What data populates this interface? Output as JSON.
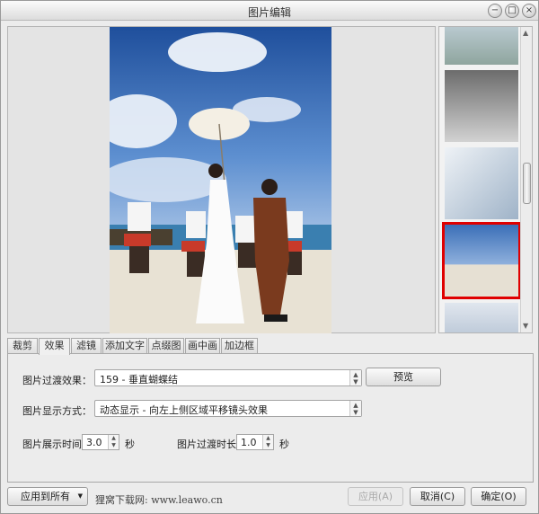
{
  "window": {
    "title": "图片编辑"
  },
  "tabs": [
    {
      "label": "裁剪"
    },
    {
      "label": "效果"
    },
    {
      "label": "滤镜"
    },
    {
      "label": "添加文字"
    },
    {
      "label": "点缀图"
    },
    {
      "label": "画中画"
    },
    {
      "label": "加边框"
    }
  ],
  "active_tab": "效果",
  "effects": {
    "transition_label": "图片过渡效果：",
    "transition_value": "159 - 垂直蝴蝶结",
    "preview_button": "预览",
    "display_label": "图片显示方式：",
    "display_value": "动态显示 - 向左上侧区域平移镜头效果",
    "show_time_label": "图片展示时间:",
    "show_time_value": "3.0",
    "show_time_unit": "秒",
    "transition_time_label": "图片过渡时长:",
    "transition_time_value": "1.0",
    "transition_time_unit": "秒"
  },
  "footer": {
    "apply_all_button": "应用到所有",
    "watermark": "狸窝下载网: www.leawo.cn",
    "apply_button": "应用(A)",
    "cancel_button": "取消(C)",
    "ok_button": "确定(O)"
  },
  "thumbnails": {
    "selected_index": 3,
    "count": 5
  },
  "colors": {
    "selection": "#e00000",
    "sky": "#2f64b4",
    "sand": "#e8e2d4"
  }
}
